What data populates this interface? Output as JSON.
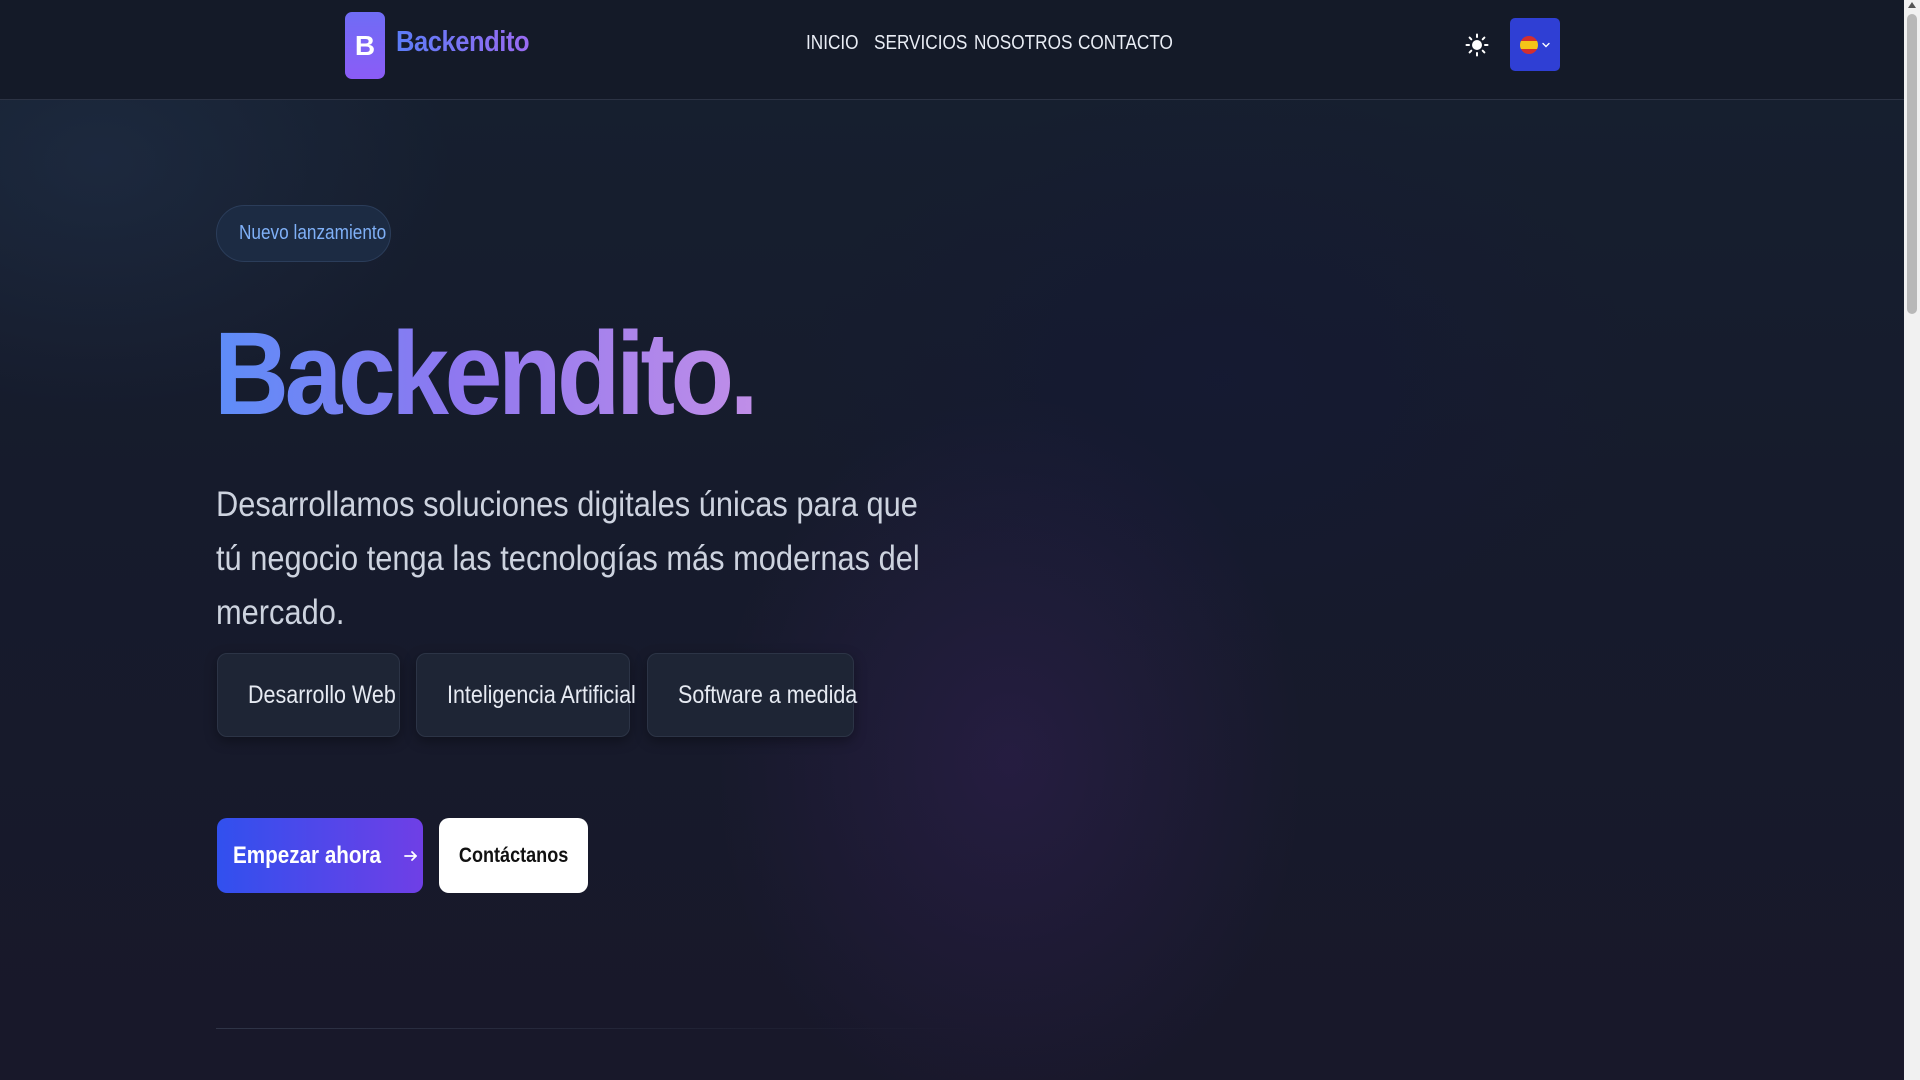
{
  "header": {
    "logo_letter": "B",
    "brand": "Backendito",
    "nav": [
      "INICIO",
      "SERVICIOS",
      "NOSOTROS",
      "CONTACTO"
    ],
    "theme_icon": "sun-icon",
    "language_icon": "spain-flag-icon"
  },
  "hero": {
    "badge": "Nuevo lanzamiento",
    "badge_icon": "sparkles-icon",
    "title": "Backendito.",
    "subtitle": "Desarrollamos soluciones digitales únicas para que tú negocio tenga las tecnologías más modernas del mercado.",
    "features": [
      {
        "label": "Desarrollo Web",
        "icon": "code-icon"
      },
      {
        "label": "Inteligencia Artificial",
        "icon": "brain-icon"
      },
      {
        "label": "Software a medida",
        "icon": "shield-icon"
      }
    ],
    "primary_cta": "Empezar ahora",
    "secondary_cta": "Contáctanos"
  },
  "colors": {
    "background": "#161b2c",
    "accent_blue": "#3150ee",
    "accent_purple": "#8b5cf6",
    "badge_text": "#7fb0f7"
  }
}
